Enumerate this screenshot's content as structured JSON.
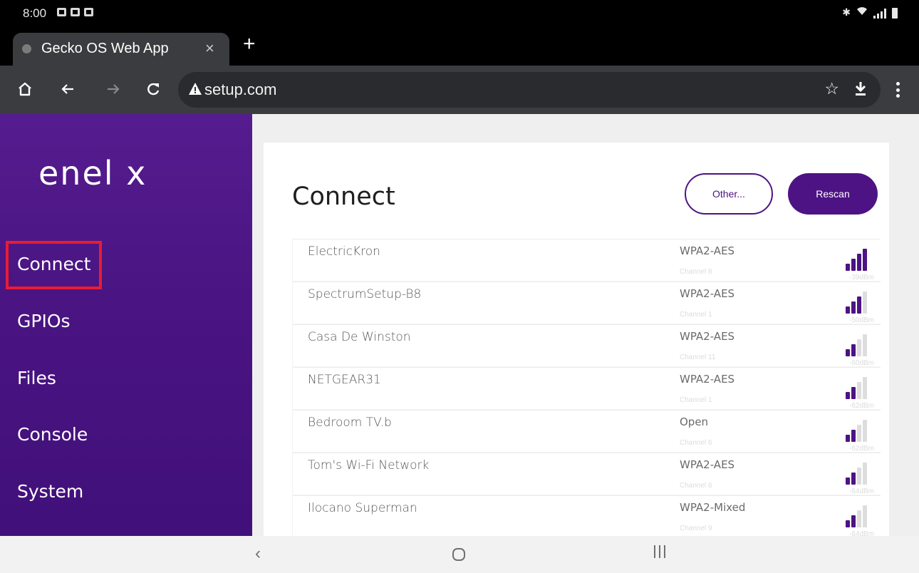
{
  "status_bar": {
    "time": "8:00"
  },
  "browser": {
    "tab": {
      "title": "Gecko OS Web App",
      "close": "×"
    },
    "new_tab": "+",
    "url": "setup.com",
    "star": "☆"
  },
  "sidebar": {
    "logo": "enel x",
    "items": [
      {
        "label": "Connect",
        "selected": true
      },
      {
        "label": "GPIOs"
      },
      {
        "label": "Files"
      },
      {
        "label": "Console"
      },
      {
        "label": "System"
      }
    ]
  },
  "main": {
    "title": "Connect",
    "other_label": "Other...",
    "rescan_label": "Rescan",
    "networks": [
      {
        "ssid": "ElectricKron",
        "security": "WPA2-AES",
        "channel": "Channel 8",
        "rssi": "-39dBm",
        "strength_bars": 4
      },
      {
        "ssid": "SpectrumSetup-B8",
        "security": "WPA2-AES",
        "channel": "Channel 1",
        "rssi": "-50dBm",
        "strength_bars": 3
      },
      {
        "ssid": "Casa De Winston",
        "security": "WPA2-AES",
        "channel": "Channel 11",
        "rssi": "-60dBm",
        "strength_bars": 2
      },
      {
        "ssid": "NETGEAR31",
        "security": "WPA2-AES",
        "channel": "Channel 1",
        "rssi": "-62dBm",
        "strength_bars": 2
      },
      {
        "ssid": "Bedroom TV.b",
        "security": "Open",
        "channel": "Channel 6",
        "rssi": "-62dBm",
        "strength_bars": 2
      },
      {
        "ssid": "Tom's Wi-Fi Network",
        "security": "WPA2-AES",
        "channel": "Channel 6",
        "rssi": "-64dBm",
        "strength_bars": 2
      },
      {
        "ssid": "Ilocano Superman",
        "security": "WPA2-Mixed",
        "channel": "Channel 9",
        "rssi": "-64dBm",
        "strength_bars": 2
      }
    ]
  },
  "colors": {
    "brand_purple": "#4d1384",
    "highlight_red": "#e81c33",
    "bar_active": "#4d1384",
    "bar_inactive": "#dddddd"
  }
}
